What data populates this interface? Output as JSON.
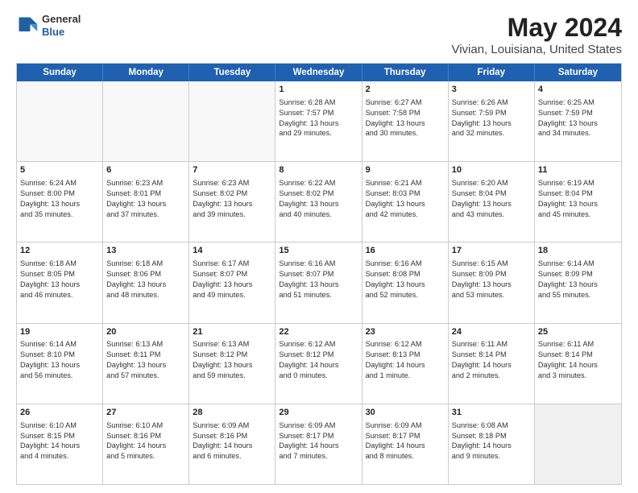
{
  "header": {
    "logo": {
      "general": "General",
      "blue": "Blue"
    },
    "title": "May 2024",
    "subtitle": "Vivian, Louisiana, United States"
  },
  "weekdays": [
    "Sunday",
    "Monday",
    "Tuesday",
    "Wednesday",
    "Thursday",
    "Friday",
    "Saturday"
  ],
  "weeks": [
    [
      {
        "day": "",
        "empty": true
      },
      {
        "day": "",
        "empty": true
      },
      {
        "day": "",
        "empty": true
      },
      {
        "day": "1",
        "lines": [
          "Sunrise: 6:28 AM",
          "Sunset: 7:57 PM",
          "Daylight: 13 hours",
          "and 29 minutes."
        ]
      },
      {
        "day": "2",
        "lines": [
          "Sunrise: 6:27 AM",
          "Sunset: 7:58 PM",
          "Daylight: 13 hours",
          "and 30 minutes."
        ]
      },
      {
        "day": "3",
        "lines": [
          "Sunrise: 6:26 AM",
          "Sunset: 7:59 PM",
          "Daylight: 13 hours",
          "and 32 minutes."
        ]
      },
      {
        "day": "4",
        "lines": [
          "Sunrise: 6:25 AM",
          "Sunset: 7:59 PM",
          "Daylight: 13 hours",
          "and 34 minutes."
        ]
      }
    ],
    [
      {
        "day": "5",
        "lines": [
          "Sunrise: 6:24 AM",
          "Sunset: 8:00 PM",
          "Daylight: 13 hours",
          "and 35 minutes."
        ]
      },
      {
        "day": "6",
        "lines": [
          "Sunrise: 6:23 AM",
          "Sunset: 8:01 PM",
          "Daylight: 13 hours",
          "and 37 minutes."
        ]
      },
      {
        "day": "7",
        "lines": [
          "Sunrise: 6:23 AM",
          "Sunset: 8:02 PM",
          "Daylight: 13 hours",
          "and 39 minutes."
        ]
      },
      {
        "day": "8",
        "lines": [
          "Sunrise: 6:22 AM",
          "Sunset: 8:02 PM",
          "Daylight: 13 hours",
          "and 40 minutes."
        ]
      },
      {
        "day": "9",
        "lines": [
          "Sunrise: 6:21 AM",
          "Sunset: 8:03 PM",
          "Daylight: 13 hours",
          "and 42 minutes."
        ]
      },
      {
        "day": "10",
        "lines": [
          "Sunrise: 6:20 AM",
          "Sunset: 8:04 PM",
          "Daylight: 13 hours",
          "and 43 minutes."
        ]
      },
      {
        "day": "11",
        "lines": [
          "Sunrise: 6:19 AM",
          "Sunset: 8:04 PM",
          "Daylight: 13 hours",
          "and 45 minutes."
        ]
      }
    ],
    [
      {
        "day": "12",
        "lines": [
          "Sunrise: 6:18 AM",
          "Sunset: 8:05 PM",
          "Daylight: 13 hours",
          "and 46 minutes."
        ]
      },
      {
        "day": "13",
        "lines": [
          "Sunrise: 6:18 AM",
          "Sunset: 8:06 PM",
          "Daylight: 13 hours",
          "and 48 minutes."
        ]
      },
      {
        "day": "14",
        "lines": [
          "Sunrise: 6:17 AM",
          "Sunset: 8:07 PM",
          "Daylight: 13 hours",
          "and 49 minutes."
        ]
      },
      {
        "day": "15",
        "lines": [
          "Sunrise: 6:16 AM",
          "Sunset: 8:07 PM",
          "Daylight: 13 hours",
          "and 51 minutes."
        ]
      },
      {
        "day": "16",
        "lines": [
          "Sunrise: 6:16 AM",
          "Sunset: 8:08 PM",
          "Daylight: 13 hours",
          "and 52 minutes."
        ]
      },
      {
        "day": "17",
        "lines": [
          "Sunrise: 6:15 AM",
          "Sunset: 8:09 PM",
          "Daylight: 13 hours",
          "and 53 minutes."
        ]
      },
      {
        "day": "18",
        "lines": [
          "Sunrise: 6:14 AM",
          "Sunset: 8:09 PM",
          "Daylight: 13 hours",
          "and 55 minutes."
        ]
      }
    ],
    [
      {
        "day": "19",
        "lines": [
          "Sunrise: 6:14 AM",
          "Sunset: 8:10 PM",
          "Daylight: 13 hours",
          "and 56 minutes."
        ]
      },
      {
        "day": "20",
        "lines": [
          "Sunrise: 6:13 AM",
          "Sunset: 8:11 PM",
          "Daylight: 13 hours",
          "and 57 minutes."
        ]
      },
      {
        "day": "21",
        "lines": [
          "Sunrise: 6:13 AM",
          "Sunset: 8:12 PM",
          "Daylight: 13 hours",
          "and 59 minutes."
        ]
      },
      {
        "day": "22",
        "lines": [
          "Sunrise: 6:12 AM",
          "Sunset: 8:12 PM",
          "Daylight: 14 hours",
          "and 0 minutes."
        ]
      },
      {
        "day": "23",
        "lines": [
          "Sunrise: 6:12 AM",
          "Sunset: 8:13 PM",
          "Daylight: 14 hours",
          "and 1 minute."
        ]
      },
      {
        "day": "24",
        "lines": [
          "Sunrise: 6:11 AM",
          "Sunset: 8:14 PM",
          "Daylight: 14 hours",
          "and 2 minutes."
        ]
      },
      {
        "day": "25",
        "lines": [
          "Sunrise: 6:11 AM",
          "Sunset: 8:14 PM",
          "Daylight: 14 hours",
          "and 3 minutes."
        ]
      }
    ],
    [
      {
        "day": "26",
        "lines": [
          "Sunrise: 6:10 AM",
          "Sunset: 8:15 PM",
          "Daylight: 14 hours",
          "and 4 minutes."
        ]
      },
      {
        "day": "27",
        "lines": [
          "Sunrise: 6:10 AM",
          "Sunset: 8:16 PM",
          "Daylight: 14 hours",
          "and 5 minutes."
        ]
      },
      {
        "day": "28",
        "lines": [
          "Sunrise: 6:09 AM",
          "Sunset: 8:16 PM",
          "Daylight: 14 hours",
          "and 6 minutes."
        ]
      },
      {
        "day": "29",
        "lines": [
          "Sunrise: 6:09 AM",
          "Sunset: 8:17 PM",
          "Daylight: 14 hours",
          "and 7 minutes."
        ]
      },
      {
        "day": "30",
        "lines": [
          "Sunrise: 6:09 AM",
          "Sunset: 8:17 PM",
          "Daylight: 14 hours",
          "and 8 minutes."
        ]
      },
      {
        "day": "31",
        "lines": [
          "Sunrise: 6:08 AM",
          "Sunset: 8:18 PM",
          "Daylight: 14 hours",
          "and 9 minutes."
        ]
      },
      {
        "day": "",
        "empty": true,
        "shaded": true
      }
    ]
  ]
}
